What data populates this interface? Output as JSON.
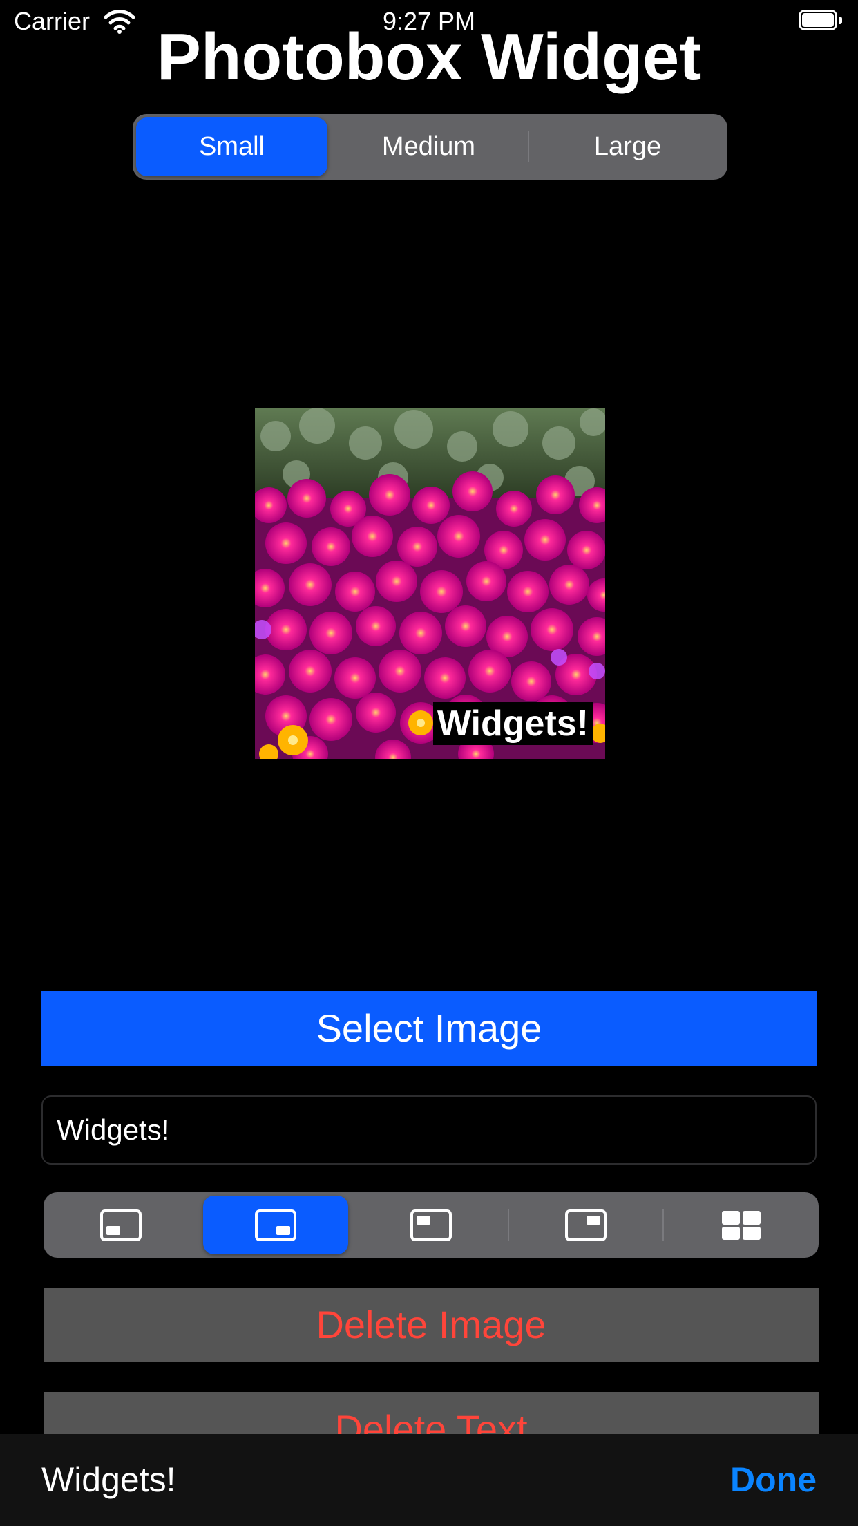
{
  "status_bar": {
    "carrier": "Carrier",
    "time": "9:27 PM"
  },
  "title": "Photobox Widget",
  "size_picker": {
    "options": [
      "Small",
      "Medium",
      "Large"
    ],
    "selected": "Small"
  },
  "preview": {
    "caption": "Widgets!"
  },
  "select_image_label": "Select Image",
  "text_field": {
    "value": "Widgets!",
    "placeholder": ""
  },
  "layout_picker": {
    "options": [
      "bottom-left-icon",
      "bottom-right-icon",
      "top-left-icon",
      "top-right-icon",
      "grid-icon"
    ],
    "selected": "bottom-right-icon"
  },
  "delete_image_label": "Delete Image",
  "delete_text_label": "Delete Text",
  "accessory_bar": {
    "label": "Widgets!",
    "done_label": "Done"
  },
  "colors": {
    "accent": "#0a5cff",
    "destructive": "#ff453a",
    "done": "#0a84ff",
    "segment_background": "#636366"
  }
}
